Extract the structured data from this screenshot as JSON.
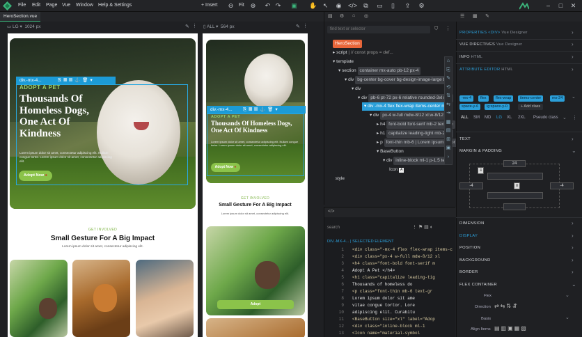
{
  "menu": {
    "items": [
      "File",
      "Edit",
      "Page",
      "Vue",
      "Window",
      "Help & Settings"
    ],
    "insert": "Insert",
    "fit": "Fit"
  },
  "tab": {
    "file": "HeroSection.vue"
  },
  "preview_lg": {
    "size": "LG",
    "width": "1024 px"
  },
  "preview_all": {
    "size": "ALL",
    "width": "564 px"
  },
  "hero": {
    "adopt": "ADOPT A PET",
    "title_lg": "Thousands Of Homeless Dogs, One Act Of Kindness",
    "title_sm": "Thousands Of Homeless Dogs, One Act Of Kindness",
    "lorem": "Lorem ipsum dolor sit amet, consectetur adipiscing elit. Nullam congue tortor. Lorem ipsum dolor sit amet, consectetur adipiscing elit.",
    "button": "Adopt Now"
  },
  "section2": {
    "eyebrow": "GET INVOLVED",
    "title": "Small Gesture For A Big Impact",
    "lorem": "Lorem ipsum dolor sit amet, consectetur adipiscing elit.",
    "card_button": "Adopt"
  },
  "selection": {
    "label_lg": "div.-mx-4...",
    "label_sm": "div.-mx-4..."
  },
  "tree": {
    "search_placeholder": "find text or selector",
    "rows": [
      {
        "name": "HeroSection",
        "tag": "",
        "indent": 0
      },
      {
        "name": "script",
        "tag": "| // const props = def...",
        "indent": 1
      },
      {
        "name": "template",
        "tag": "",
        "indent": 1
      },
      {
        "name": "section",
        "tag": "container mx-auto pb-12 px-4",
        "indent": 2
      },
      {
        "name": "div",
        "tag": "bg-center bg-cover bg-design-image-large bg-",
        "indent": 3
      },
      {
        "name": "div",
        "tag": "",
        "indent": 4
      },
      {
        "name": "div",
        "tag": "pb-6 pt-72 px-6 relative rounded-3xl md:",
        "indent": 5
      },
      {
        "name": "div",
        "tag": "-mx-4 flex flex-wrap items-center mx",
        "indent": 6
      },
      {
        "name": "div",
        "tag": "px-4 w-full mdw-8/12 xl:w-8/12",
        "indent": 7
      },
      {
        "name": "h4",
        "tag": "font-bold font-serif mb-2 text-gre",
        "indent": 8
      },
      {
        "name": "h1",
        "tag": "capitalize leading-tight mb-2 for",
        "indent": 8
      },
      {
        "name": "p",
        "tag": "font-thin mb-6 | Lorem ipsum dolor",
        "indent": 8
      },
      {
        "name": "BaseButton",
        "tag": "",
        "indent": 8
      },
      {
        "name": "div",
        "tag": "inline-block ml-1 p-1.5 text-",
        "indent": 9
      },
      {
        "name": "Icon",
        "tag": "",
        "indent": 10
      },
      {
        "name": "style",
        "tag": "",
        "indent": 1
      }
    ]
  },
  "code": {
    "search_placeholder": "search",
    "breadcrumb": "DIV.-MX-4... | SELECTED ELEMENT",
    "lines": [
      {
        "n": "1",
        "t": "<div class=\"-mx-4 flex flex-wrap items-c"
      },
      {
        "n": "2",
        "t": "  <div class=\"px-4 w-full mdw-8/12 xl"
      },
      {
        "n": "3",
        "t": "    <h4 class=\"font-bold font-serif m"
      },
      {
        "n": "4",
        "t": "      Adopt A Pet </h4>"
      },
      {
        "n": "5",
        "t": "    <h1 class=\"capitalize leading-tig"
      },
      {
        "n": "6",
        "t": "      Thousands of homeless do"
      },
      {
        "n": "7",
        "t": "    <p class=\"font-thin mb-6 text-gr"
      },
      {
        "n": "8",
        "t": "      Lorem ipsum dolor sit ame"
      },
      {
        "n": "9",
        "t": "      vitae congue tortor. Lore"
      },
      {
        "n": "10",
        "t": "      adipiscing elit. Curabitu"
      },
      {
        "n": "11",
        "t": "    <BaseButton size=\"xl\" label=\"Adop"
      },
      {
        "n": "12",
        "t": "      <div class=\"inline-block ml-1"
      },
      {
        "n": "13",
        "t": "        <Icon name=\"material-symbol"
      },
      {
        "n": "14",
        "t": "      </div>"
      },
      {
        "n": "15",
        "t": "    </BaseButton>"
      }
    ]
  },
  "right": {
    "properties": "PROPERTIES <DIV>",
    "properties_sub": "Vue Designer",
    "vue_directives": "VUE DIRECTIVES",
    "vue_sub": "Vue Designer",
    "info": "INFO",
    "info_sub": "HTML",
    "attr": "ATTRIBUTE EDITOR",
    "attr_sub": "HTML",
    "chips": [
      "-mx-4",
      "flex",
      "flex-wrap",
      "items-center",
      "mx-24"
    ],
    "chips2": [
      "space-y-6",
      "lg:space-y-0"
    ],
    "add_class": "+ Add class",
    "breakpoints": [
      "ALL",
      "SM",
      "MD",
      "LG",
      "XL",
      "2XL"
    ],
    "pseudo": "Pseudo class",
    "text": "TEXT",
    "margin_padding": "MARGIN & PADDING",
    "margin": {
      "top": "24",
      "left": "-4",
      "right": "-4"
    },
    "sections": [
      "DIMENSION",
      "DISPLAY",
      "POSITION",
      "BACKGROUND",
      "BORDER",
      "FLEX CONTAINER"
    ],
    "flex_rows": [
      "Flex",
      "Direction",
      "Basis",
      "Align Items"
    ]
  },
  "colors": {
    "accent": "#2b9fd9",
    "green": "#8bc34a",
    "bg": "#1f2023"
  }
}
